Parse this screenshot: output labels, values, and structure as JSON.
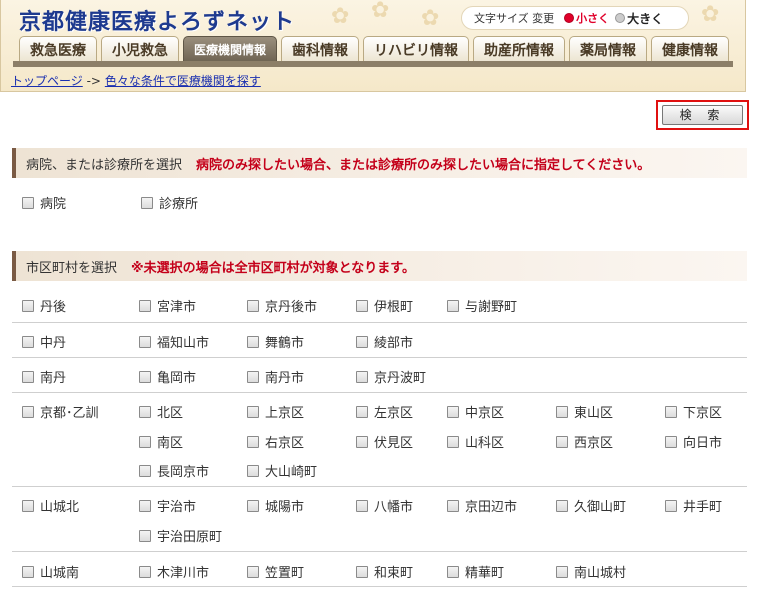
{
  "header": {
    "site_title": "京都健康医療よろずネット",
    "font_size": {
      "label": "文字サイズ 変更",
      "small": "小さく",
      "large": "大きく"
    },
    "tabs": [
      "救急医療",
      "小児救急",
      "医療機関情報",
      "歯科情報",
      "リハビリ情報",
      "助産所情報",
      "薬局情報",
      "健康情報"
    ],
    "active_tab": "医療機関情報"
  },
  "breadcrumb": {
    "home": "トップページ",
    "sep": "->",
    "current": "色々な条件で医療機関を探す"
  },
  "search_button": "検 索",
  "facility_section": {
    "label": "病院、または診療所を選択",
    "note": "病院のみ探したい場合、または診療所のみ探したい場合に指定してください。",
    "options": [
      "病院",
      "診療所"
    ]
  },
  "area_section": {
    "label": "市区町村を選択",
    "note": "※未選択の場合は全市区町村が対象となります。",
    "rows": [
      {
        "region": "丹後",
        "cities": [
          "宮津市",
          "京丹後市",
          "伊根町",
          "与謝野町"
        ]
      },
      {
        "region": "中丹",
        "cities": [
          "福知山市",
          "舞鶴市",
          "綾部市"
        ]
      },
      {
        "region": "南丹",
        "cities": [
          "亀岡市",
          "南丹市",
          "京丹波町"
        ]
      },
      {
        "region": "京都･乙訓",
        "cities": [
          "北区",
          "上京区",
          "左京区",
          "中京区",
          "東山区",
          "下京区",
          "南区",
          "右京区",
          "伏見区",
          "山科区",
          "西京区",
          "向日市",
          "長岡京市",
          "大山崎町"
        ]
      },
      {
        "region": "山城北",
        "cities": [
          "宇治市",
          "城陽市",
          "八幡市",
          "京田辺市",
          "久御山町",
          "井手町",
          "宇治田原町"
        ]
      },
      {
        "region": "山城南",
        "cities": [
          "木津川市",
          "笠置町",
          "和束町",
          "精華町",
          "南山城村"
        ]
      }
    ]
  }
}
